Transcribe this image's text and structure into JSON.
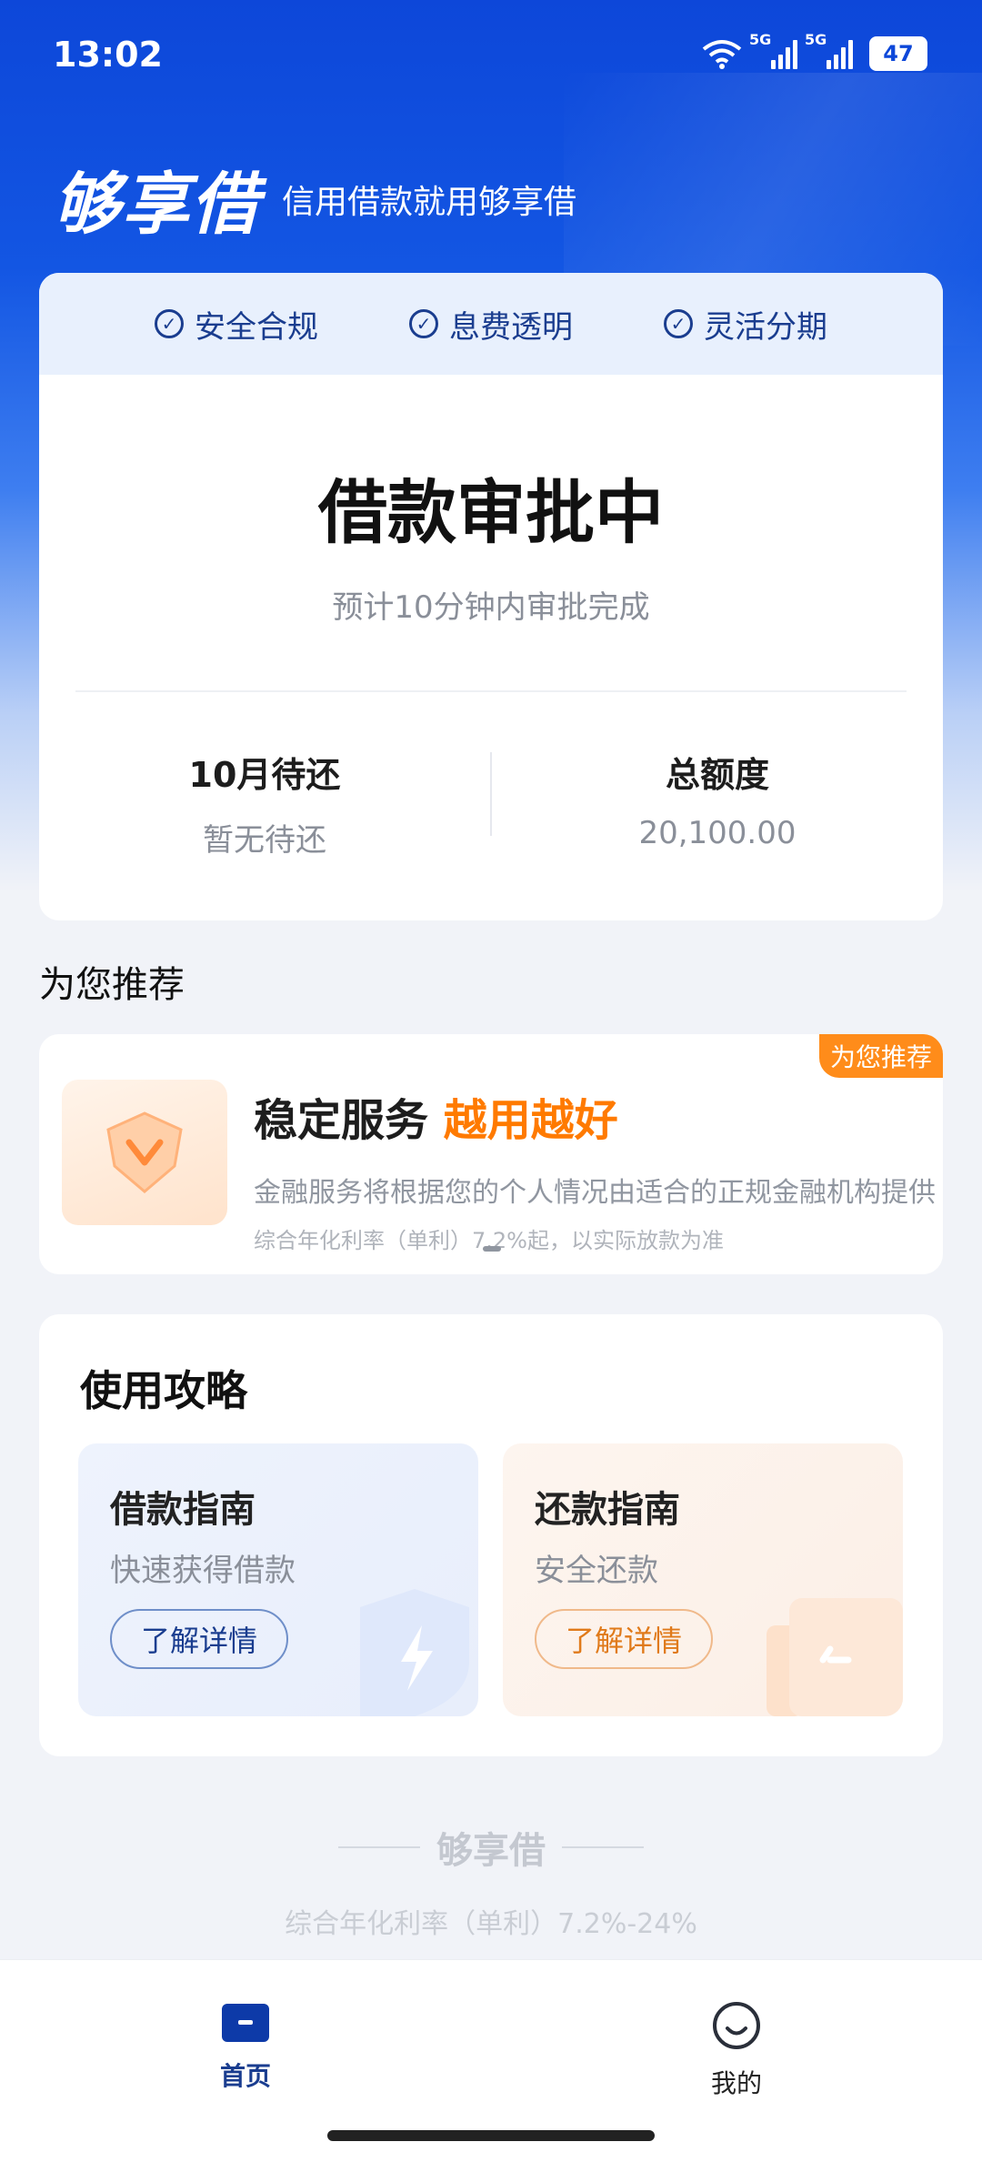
{
  "status_bar": {
    "time": "13:02",
    "signal1": "5G",
    "signal2": "5G",
    "battery": "47"
  },
  "header": {
    "brand": "够享借",
    "slogan": "信用借款就用够享借"
  },
  "badges": [
    "安全合规",
    "息费透明",
    "灵活分期"
  ],
  "loan_status": {
    "title": "借款审批中",
    "subtitle": "预计10分钟内审批完成",
    "due_label": "10月待还",
    "due_value": "暂无待还",
    "limit_label": "总额度",
    "limit_value": "20,100.00"
  },
  "recommend": {
    "section_title": "为您推荐",
    "corner_tag": "为您推荐",
    "title_main": "稳定服务",
    "title_highlight": "越用越好",
    "desc": "金融服务将根据您的个人情况由适合的正规金融机构提供",
    "note": "综合年化利率（单利）7.2%起，以实际放款为准"
  },
  "guide": {
    "title": "使用攻略",
    "borrow": {
      "title": "借款指南",
      "subtitle": "快速获得借款",
      "button": "了解详情"
    },
    "repay": {
      "title": "还款指南",
      "subtitle": "安全还款",
      "button": "了解详情"
    }
  },
  "footer": {
    "brand": "够享借",
    "note": "综合年化利率（单利）7.2%-24%"
  },
  "tabbar": {
    "home": "首页",
    "mine": "我的"
  },
  "colors": {
    "primary": "#0d47d9",
    "accent_orange": "#ff7a00",
    "nav_active": "#1a3d8f"
  }
}
